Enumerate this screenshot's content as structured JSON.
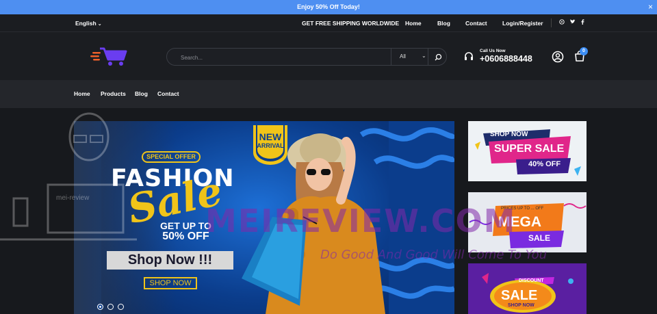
{
  "announcement": {
    "text": "Enjoy 50% Off Today!",
    "close": "×"
  },
  "topbar": {
    "language": "English",
    "shipping": "GET FREE SHIPPING WORLDWIDE",
    "links": [
      "Home",
      "Blog",
      "Contact",
      "Login/Register"
    ],
    "social": [
      "whatsapp-icon",
      "twitter-icon",
      "facebook-icon"
    ]
  },
  "header": {
    "search_placeholder": "Search...",
    "category": "All",
    "call_label": "Call Us Now",
    "phone": "+0606888448",
    "cart_count": "0"
  },
  "nav": [
    "Home",
    "Products",
    "Blog",
    "Contact"
  ],
  "hero": {
    "special_offer": "SPECIAL OFFER",
    "fashion": "FASHION",
    "sale": "Sale",
    "get_up_to": "GET UP TO",
    "discount": "50% OFF",
    "shop_now_big": "Shop Now !!!",
    "shop_now_small": "SHOP NOW",
    "new": "NEW",
    "arrival": "ARRIVAL",
    "slides": 3
  },
  "ads": [
    {
      "top": "SHOP NOW",
      "main": "SUPER SALE",
      "sub": "40% OFF"
    },
    {
      "top": "PRICES UP TO ... OFF",
      "main": "MEGA",
      "sub": "SALE"
    },
    {
      "top": "DISCOUNT",
      "main": "SALE",
      "sub": "SHOP NOW"
    }
  ],
  "watermark": {
    "main": "MEIREVIEW.COM",
    "sub": "Do Good And Good Will Come To You",
    "label": "mei-review"
  }
}
